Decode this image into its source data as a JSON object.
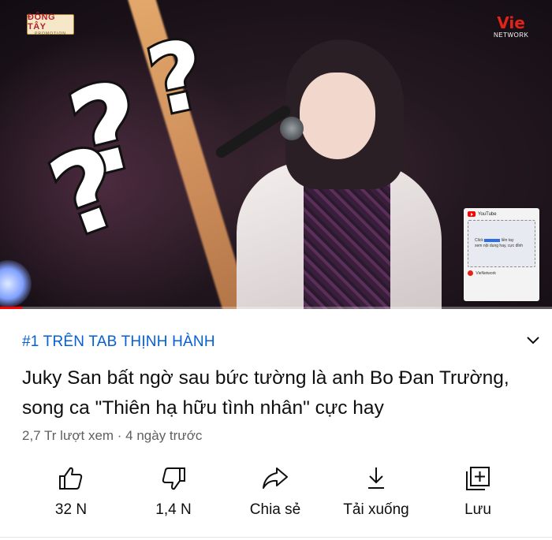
{
  "video": {
    "logo_left_line1": "ĐÔNG TÂY",
    "logo_left_line2": "PROMOTION",
    "logo_right_line1": "Vie",
    "logo_right_line2": "NETWORK",
    "promo_card": {
      "app_name": "YouTube",
      "line1": "Click",
      "line1_rest": "liền tay",
      "line2": "xem nội dung hay, cực đỉnh",
      "channel": "VieNetwork"
    },
    "progress_fraction": 0.04,
    "colors": {
      "progress": "#ff0000",
      "track": "#ffffffff"
    }
  },
  "details": {
    "trending_label": "#1 TRÊN TAB THỊNH HÀNH",
    "title": "Juky San bất ngờ sau bức tường là anh Bo Đan Trường, song ca \"Thiên hạ hữu tình nhân\" cực hay",
    "meta": "2,7 Tr lượt xem · 4 ngày trước",
    "expand_icon": "chevron-down-icon",
    "colors": {
      "trending": "#065fd4",
      "meta": "#606060",
      "text": "#0f0f0f"
    }
  },
  "actions": [
    {
      "label": "32 N",
      "icon": "thumbs-up-icon"
    },
    {
      "label": "1,4 N",
      "icon": "thumbs-down-icon"
    },
    {
      "label": "Chia sẻ",
      "icon": "share-icon"
    },
    {
      "label": "Tải xuống",
      "icon": "download-icon"
    },
    {
      "label": "Lưu",
      "icon": "playlist-add-icon"
    }
  ]
}
